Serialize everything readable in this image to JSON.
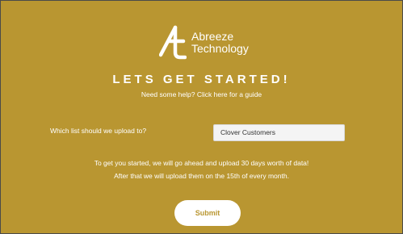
{
  "brand": {
    "logo_icon": "abreeze-logo-icon",
    "name_line1": "Abreeze",
    "name_line2": "Technology"
  },
  "heading": "LETS GET STARTED!",
  "help_link": "Need some help? Click here for a guide",
  "upload_list": {
    "label": "Which list should we upload to?",
    "selected": "Clover Customers"
  },
  "info": {
    "line1": "To get you started, we will go ahead and upload 30 days worth of data!",
    "line2": "After that we will upload them on the 15th of every month."
  },
  "submit_label": "Submit",
  "colors": {
    "background": "#b99631",
    "text": "#ffffff",
    "button_bg": "#ffffff",
    "button_text": "#b99631",
    "select_bg": "#f4f4f4"
  }
}
